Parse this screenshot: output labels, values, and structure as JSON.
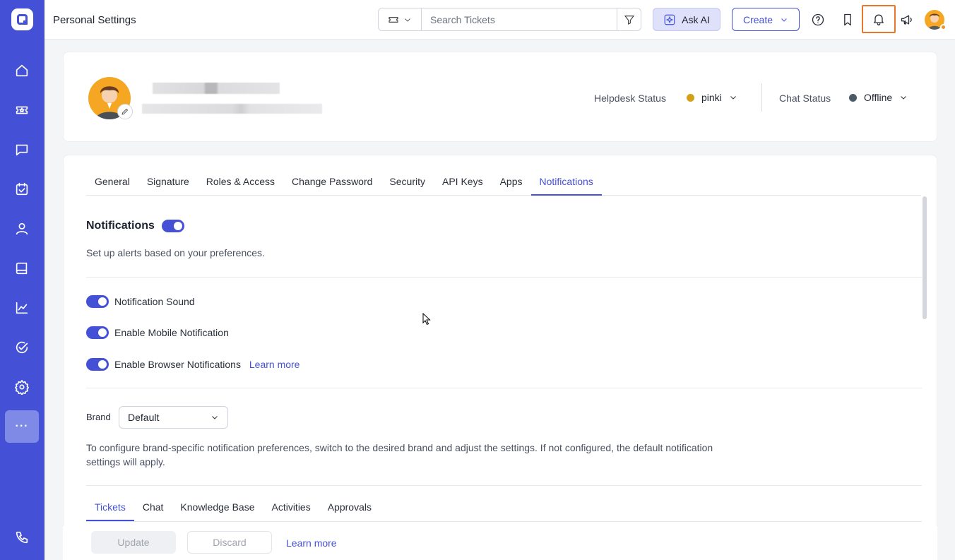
{
  "topbar": {
    "page_title": "Personal Settings",
    "search_placeholder": "Search Tickets",
    "ask_ai_label": "Ask AI",
    "create_label": "Create"
  },
  "sidebar": {
    "items": [
      {
        "icon": "home-icon"
      },
      {
        "icon": "ticket-icon"
      },
      {
        "icon": "chat-icon"
      },
      {
        "icon": "calendar-check-icon"
      },
      {
        "icon": "user-icon"
      },
      {
        "icon": "book-icon"
      },
      {
        "icon": "chart-icon"
      },
      {
        "icon": "check-circle-icon"
      },
      {
        "icon": "gear-icon"
      },
      {
        "icon": "more-icon",
        "label": "···"
      },
      {
        "icon": "phone-icon"
      }
    ]
  },
  "profile": {
    "helpdesk_status_label": "Helpdesk Status",
    "helpdesk_status_value": "pinki",
    "helpdesk_status_color": "#d4a017",
    "chat_status_label": "Chat Status",
    "chat_status_value": "Offline",
    "chat_status_color": "#4a5a66"
  },
  "tabs": [
    "General",
    "Signature",
    "Roles & Access",
    "Change Password",
    "Security",
    "API Keys",
    "Apps",
    "Notifications"
  ],
  "active_tab": "Notifications",
  "notifications": {
    "title": "Notifications",
    "enabled": true,
    "description": "Set up alerts based on your preferences.",
    "options": [
      {
        "label": "Notification Sound",
        "enabled": true
      },
      {
        "label": "Enable Mobile Notification",
        "enabled": true
      },
      {
        "label": "Enable Browser Notifications",
        "enabled": true,
        "link": "Learn more"
      }
    ]
  },
  "brand": {
    "label": "Brand",
    "selected": "Default",
    "description": "To configure brand-specific notification preferences, switch to the desired brand and adjust the settings. If not configured, the default notification settings will apply."
  },
  "subtabs": [
    "Tickets",
    "Chat",
    "Knowledge Base",
    "Activities",
    "Approvals"
  ],
  "active_subtab": "Tickets",
  "footer": {
    "update_label": "Update",
    "discard_label": "Discard",
    "learn_more": "Learn more"
  },
  "colors": {
    "brand": "#4451d6",
    "highlight": "#e8762b"
  }
}
